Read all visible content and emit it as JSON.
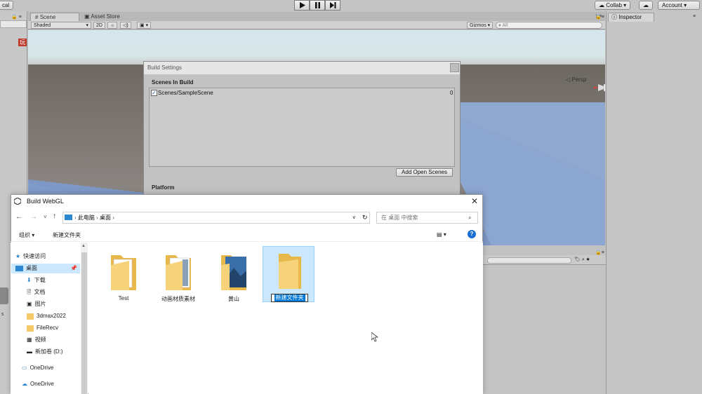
{
  "toolbar": {
    "left_button": "cal",
    "collab": "Collab ▾",
    "account": "Account ▾"
  },
  "hierarchy": {
    "badge": "玩"
  },
  "scene": {
    "tabs": [
      "Scene",
      "Asset Store"
    ],
    "shading": "Shaded",
    "mode_2d": "2D",
    "gizmos": "Gizmos ▾",
    "search_placeholder": "All",
    "persp_label": "◁ Persp"
  },
  "inspector": {
    "tab": "Inspector"
  },
  "build_settings": {
    "title": "Build Settings",
    "scenes_header": "Scenes In Build",
    "scenes": [
      {
        "name": "Scenes/SampleScene",
        "index": "0",
        "checked": true
      }
    ],
    "add_open_scenes": "Add Open Scenes",
    "platform_header": "Platform"
  },
  "dialog": {
    "title": "Build WebGL",
    "breadcrumb": [
      "此电脑",
      "桌面"
    ],
    "search_placeholder": "在 桌面 中搜索",
    "organize": "组织 ▾",
    "new_folder": "新建文件夹",
    "nav": [
      {
        "label": "快速访问",
        "icon": "star-icon"
      },
      {
        "label": "桌面",
        "icon": "desktop-icon",
        "selected": true
      },
      {
        "label": "下载",
        "icon": "download-icon"
      },
      {
        "label": "文档",
        "icon": "document-icon"
      },
      {
        "label": "图片",
        "icon": "picture-icon"
      },
      {
        "label": "3dmax2022",
        "icon": "folder-icon"
      },
      {
        "label": "FileRecv",
        "icon": "folder-icon"
      },
      {
        "label": "视频",
        "icon": "video-icon"
      },
      {
        "label": "新加卷 (D:)",
        "icon": "drive-icon"
      },
      {
        "label": "OneDrive",
        "icon": "onedrive-icon"
      },
      {
        "label": "OneDrive",
        "icon": "cloud-icon"
      }
    ],
    "files": [
      {
        "name": "Test"
      },
      {
        "name": "动画材质素材"
      },
      {
        "name": "黄山"
      },
      {
        "name": "新建文件夹",
        "renaming": true
      }
    ]
  },
  "colors": {
    "selection": "#cce8ff",
    "rename_highlight": "#0078d7",
    "folder": "#f3c969"
  }
}
